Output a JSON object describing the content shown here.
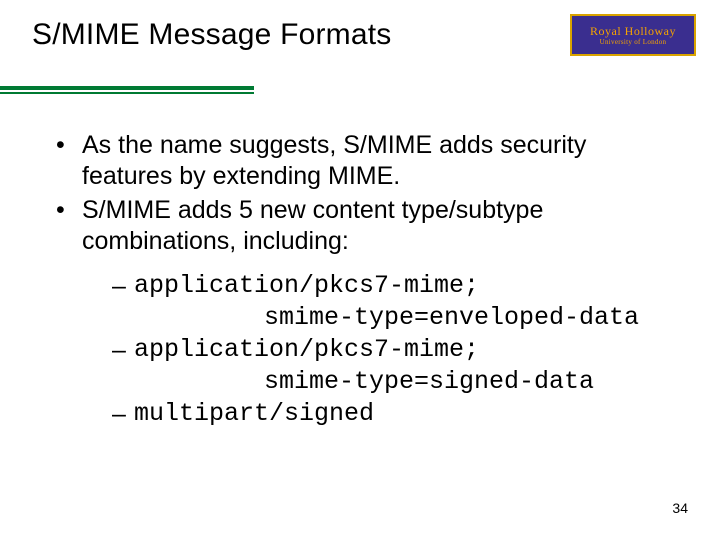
{
  "title": "S/MIME Message Formats",
  "logo": {
    "line1": "Royal Holloway",
    "line2": "University of London"
  },
  "bullets": [
    "As the name suggests, S/MIME adds security features by extending MIME.",
    "S/MIME adds 5 new content type/subtype combinations, including:"
  ],
  "subitems": [
    {
      "line1": "application/pkcs7-mime;",
      "line2": "smime-type=enveloped-data"
    },
    {
      "line1": "application/pkcs7-mime;",
      "line2": "smime-type=signed-data"
    },
    {
      "line1": "multipart/signed",
      "line2": ""
    }
  ],
  "page_number": "34"
}
